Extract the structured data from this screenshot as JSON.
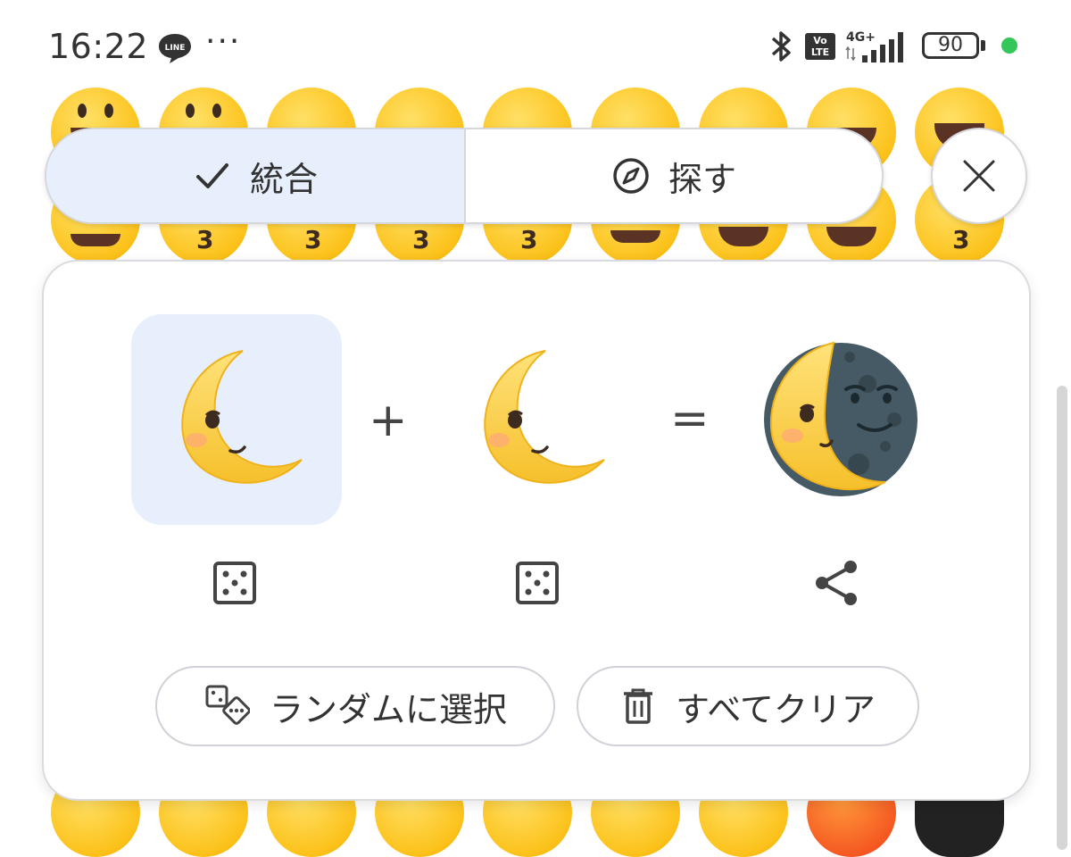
{
  "status_bar": {
    "time": "16:22",
    "line_badge": "LINE",
    "more": "···",
    "volte": [
      "Vo",
      "LTE"
    ],
    "network": "4G+",
    "battery": "90",
    "battery_level": 0.9
  },
  "tabs": {
    "merge_label": "統合",
    "explore_label": "探す",
    "selected": "merge"
  },
  "mixer": {
    "plus": "+",
    "equals": "=",
    "input_1": "crescent-moon-face",
    "input_2": "crescent-moon-face",
    "result": "crescent-moon-and-new-moon-face"
  },
  "actions": {
    "random_label": "ランダムに選択",
    "clear_label": "すべてクリア"
  },
  "colors": {
    "accent_bg": "#e8effc",
    "moon_yellow": "#fcc21b",
    "new_moon": "#455a64",
    "status_green": "#33c759"
  }
}
